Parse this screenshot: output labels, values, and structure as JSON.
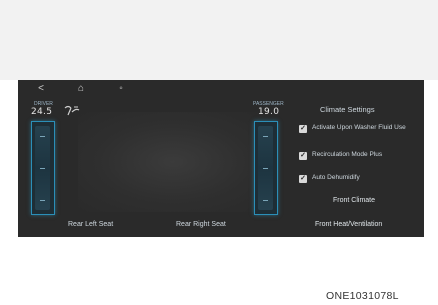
{
  "nav": {
    "back_icon": "chevron-left-icon",
    "home_icon": "home-icon",
    "menu_icon": "more-icon",
    "back_glyph": "<",
    "home_glyph": "⌂",
    "menu_glyph": "◦"
  },
  "climate": {
    "left_temp_label": "DRIVER",
    "left_temp": "24.5",
    "right_temp_label": "PASSENGER",
    "right_temp": "19.0",
    "fan_icon": "fan-icon"
  },
  "settings": {
    "title": "Climate Settings",
    "options": [
      {
        "label": "Activate Upon Washer Fluid Use",
        "checked": true
      },
      {
        "label": "Recirculation Mode Plus",
        "checked": true
      },
      {
        "label": "Auto Dehumidify",
        "checked": true
      }
    ],
    "check_glyph": "✓",
    "front_climate": "Front Climate",
    "front_heat_ventilation": "Front Heat/Ventilation"
  },
  "seats": {
    "rear_left": "Rear Left Seat",
    "rear_right": "Rear Right Seat"
  },
  "image_code": "ONE1031078L",
  "colors": {
    "screen_bg": "#2a2a2a",
    "accent": "#2b8fb8",
    "text": "#cfd8df"
  }
}
